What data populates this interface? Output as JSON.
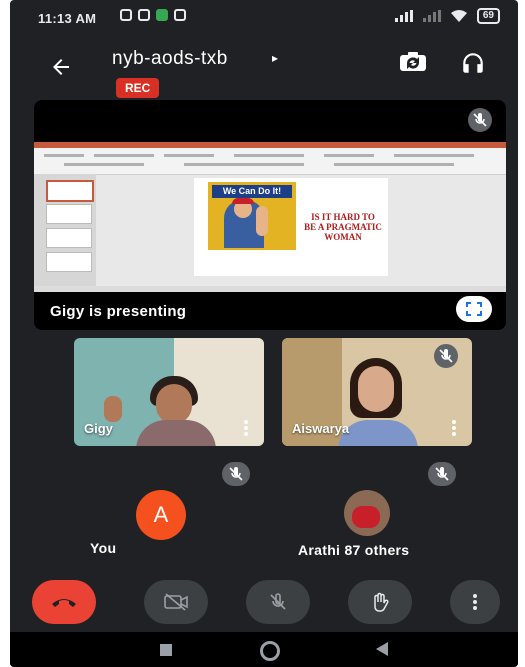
{
  "status_bar": {
    "time": "11:13 AM",
    "battery": "69"
  },
  "header": {
    "back_icon": "arrow-left-icon",
    "meeting_code": "nyb-aods-txb",
    "caret": "▸",
    "rec_label": "REC",
    "switch_camera_icon": "switch-camera-icon",
    "audio_icon": "headphones-icon"
  },
  "presentation": {
    "presenter_label": "Gigy is presenting",
    "slide_poster_text": "We Can Do It!",
    "slide_title": "IS IT HARD TO BE A PRAGMATIC WOMAN",
    "fullscreen_icon": "fullscreen-icon",
    "mic_state_icon": "mic-off-icon"
  },
  "participants": {
    "tiles": [
      {
        "name": "Gigy"
      },
      {
        "name": "Aiswarya",
        "mic_state_icon": "mic-off-icon"
      }
    ],
    "small": [
      {
        "label": "You",
        "avatar_letter": "A",
        "mic_state_icon": "mic-off-icon"
      },
      {
        "label": "Arathi 87 others",
        "mic_state_icon": "mic-off-icon"
      }
    ]
  },
  "controls": {
    "end_call_icon": "end-call-icon",
    "camera_icon": "camera-off-icon",
    "mic_icon": "mic-off-icon",
    "hand_icon": "raise-hand-icon",
    "more_icon": "more-vertical-icon"
  },
  "colors": {
    "background": "#202124",
    "rec_red": "#d93025",
    "end_call_red": "#ea4335",
    "avatar_orange": "#f4511e"
  }
}
